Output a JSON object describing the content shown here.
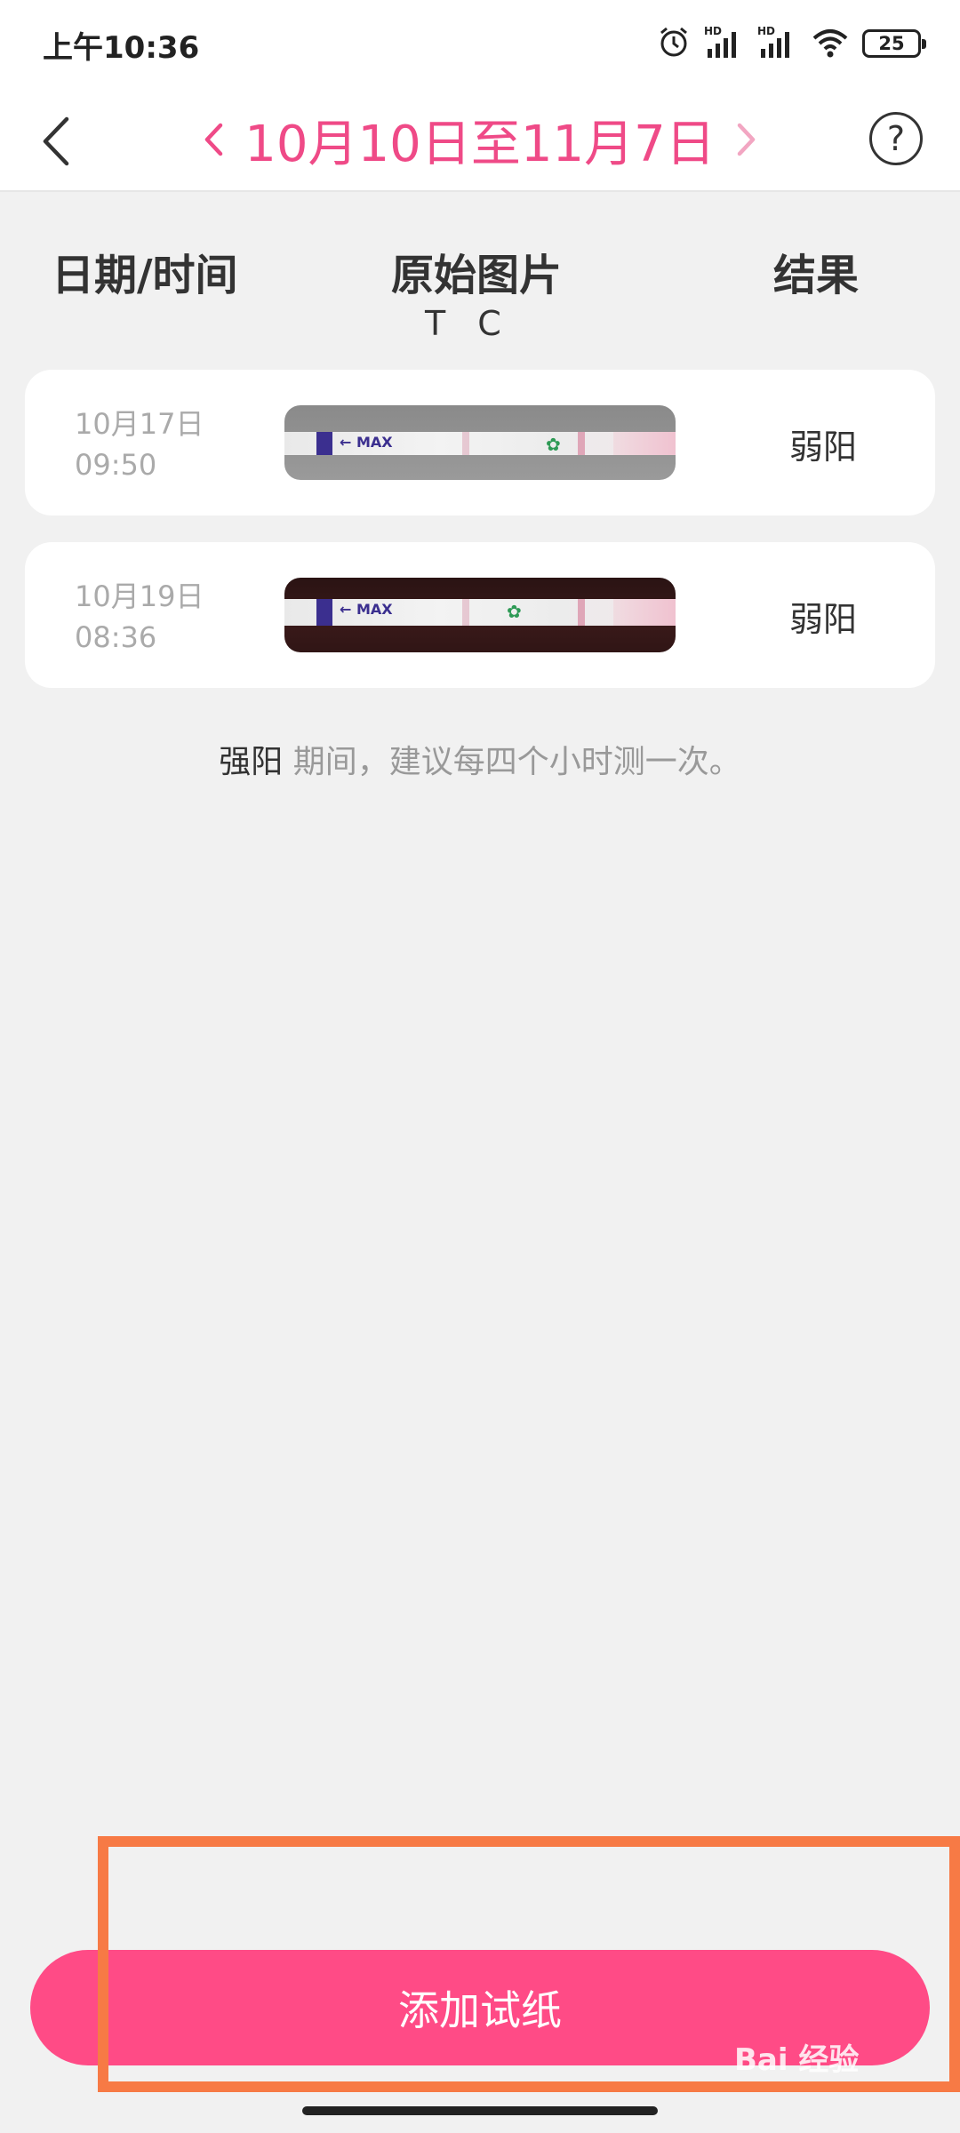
{
  "status_bar": {
    "time": "上午10:36",
    "battery": "25",
    "icons": [
      "alarm-icon",
      "hd-signal-icon",
      "hd-signal-icon",
      "wifi-icon",
      "battery-icon"
    ]
  },
  "header": {
    "date_range": "10月10日至11月7日",
    "help_label": "?",
    "accent_color": "#ef4a87"
  },
  "columns": {
    "date_time": "日期/时间",
    "original_image": "原始图片",
    "result": "结果",
    "t_label": "T",
    "c_label": "C"
  },
  "records": [
    {
      "date": "10月17日",
      "time": "09:50",
      "result": "弱阳",
      "strip_text": "← MAX"
    },
    {
      "date": "10月19日",
      "time": "08:36",
      "result": "弱阳",
      "strip_text": "← MAX"
    }
  ],
  "hint": {
    "strong": "强阳",
    "text": " 期间，建议每四个小时测一次。"
  },
  "add_button": {
    "label": "添加试纸",
    "color": "#ff4b86"
  },
  "watermark": "Bai 经验"
}
